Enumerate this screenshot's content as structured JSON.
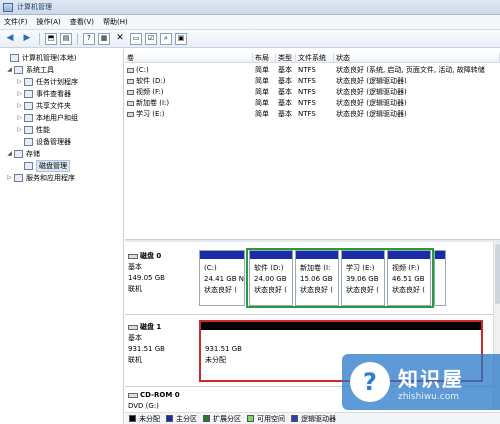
{
  "window": {
    "title": "计算机管理"
  },
  "menu": [
    "文件(F)",
    "操作(A)",
    "查看(V)",
    "帮助(H)"
  ],
  "tree": [
    {
      "label": "计算机管理(本地)",
      "exp": "",
      "level": 0
    },
    {
      "label": "系统工具",
      "exp": "◢",
      "level": 1
    },
    {
      "label": "任务计划程序",
      "exp": "▷",
      "level": 2
    },
    {
      "label": "事件查看器",
      "exp": "▷",
      "level": 2
    },
    {
      "label": "共享文件夹",
      "exp": "▷",
      "level": 2
    },
    {
      "label": "本地用户和组",
      "exp": "▷",
      "level": 2
    },
    {
      "label": "性能",
      "exp": "▷",
      "level": 2
    },
    {
      "label": "设备管理器",
      "exp": "",
      "level": 2
    },
    {
      "label": "存储",
      "exp": "◢",
      "level": 1
    },
    {
      "label": "磁盘管理",
      "exp": "",
      "level": 2,
      "selected": true
    },
    {
      "label": "服务和应用程序",
      "exp": "▷",
      "level": 1
    }
  ],
  "volume_table": {
    "columns": [
      "卷",
      "布局",
      "类型",
      "文件系统",
      "状态"
    ],
    "rows": [
      [
        "(C:)",
        "简单",
        "基本",
        "NTFS",
        "状态良好 (系统, 启动, 页面文件, 活动, 故障转储"
      ],
      [
        "软件 (D:)",
        "简单",
        "基本",
        "NTFS",
        "状态良好 (逻辑驱动器)"
      ],
      [
        "视频 (F:)",
        "简单",
        "基本",
        "NTFS",
        "状态良好 (逻辑驱动器)"
      ],
      [
        "新加卷 (I:)",
        "简单",
        "基本",
        "NTFS",
        "状态良好 (逻辑驱动器)"
      ],
      [
        "学习 (E:)",
        "简单",
        "基本",
        "NTFS",
        "状态良好 (逻辑驱动器)"
      ]
    ]
  },
  "disks": [
    {
      "name": "磁盘 0",
      "info": [
        "基本",
        "149.05 GB",
        "联机"
      ],
      "partitions": [
        {
          "lines": [
            "(C:)",
            "24.41 GB N",
            "状态良好 ("
          ],
          "bar": "#1a2da8",
          "border": "#9aa7b5"
        },
        {
          "lines": [
            "软件 (D:)",
            "24.00 GB",
            "状态良好 ("
          ],
          "bar": "#1a2da8",
          "border": "#2a9a3a"
        },
        {
          "lines": [
            "新加卷 (I:",
            "15.06 GB",
            "状态良好 ("
          ],
          "bar": "#1a2da8",
          "border": "#2a9a3a"
        },
        {
          "lines": [
            "学习 (E:)",
            "39.06 GB",
            "状态良好 ("
          ],
          "bar": "#1a2da8",
          "border": "#2a9a3a"
        },
        {
          "lines": [
            "视频 (F:)",
            "46.51 GB",
            "状态良好 ("
          ],
          "bar": "#1a2da8",
          "border": "#2a9a3a"
        }
      ]
    },
    {
      "name": "磁盘 1",
      "info": [
        "基本",
        "931.51 GB",
        "联机"
      ],
      "partitions": [
        {
          "lines": [
            "",
            "931.51 GB",
            "未分配"
          ],
          "bar": "#000000",
          "border": "#cc2a2a"
        }
      ]
    },
    {
      "name": "CD-ROM 0",
      "info": [
        "DVD (G:)"
      ],
      "partitions": []
    }
  ],
  "legend": [
    {
      "label": "未分配",
      "color": "#000000"
    },
    {
      "label": "主分区",
      "color": "#1a2da8"
    },
    {
      "label": "扩展分区",
      "color": "#2a7a2a"
    },
    {
      "label": "可用空间",
      "color": "#7cd66a"
    },
    {
      "label": "逻辑驱动器",
      "color": "#2b3fb8"
    }
  ],
  "watermark": {
    "logo": "?",
    "title": "知识屋",
    "url": "zhishiwu.com"
  }
}
